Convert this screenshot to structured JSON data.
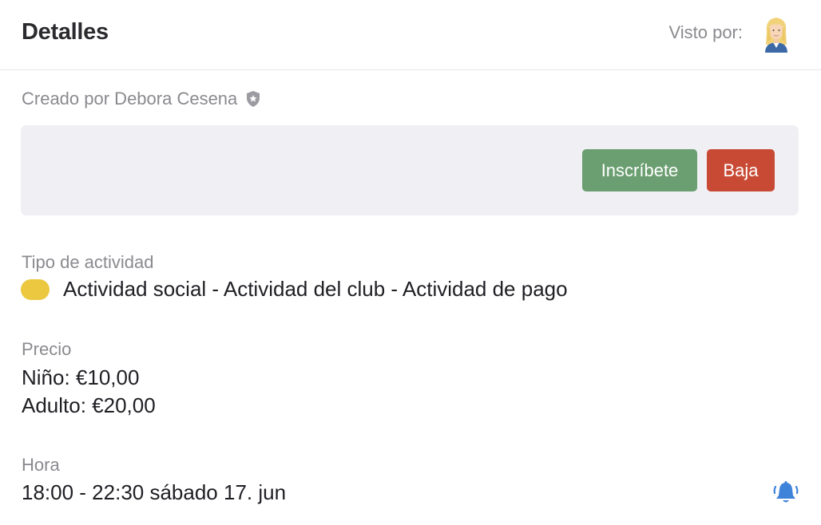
{
  "header": {
    "title": "Detalles",
    "seen_by_label": "Visto por:"
  },
  "meta": {
    "created_by": "Creado por Debora Cesena"
  },
  "actions": {
    "join_label": "Inscríbete",
    "leave_label": "Baja"
  },
  "activity_type": {
    "label": "Tipo de actividad",
    "value": "Actividad social - Actividad del club - Actividad de pago",
    "color": "#ebc83f"
  },
  "price": {
    "label": "Precio",
    "child": "Niño: €10,00",
    "adult": "Adulto: €20,00"
  },
  "time": {
    "label": "Hora",
    "value": "18:00 - 22:30 sábado 17. jun"
  },
  "colors": {
    "join_button": "#6b9f71",
    "leave_button": "#c94a34",
    "notification_icon": "#3d83d9"
  },
  "icons": {
    "avatar": "avatar",
    "shield": "shield-star-icon",
    "bell": "bell-ringing-icon"
  }
}
